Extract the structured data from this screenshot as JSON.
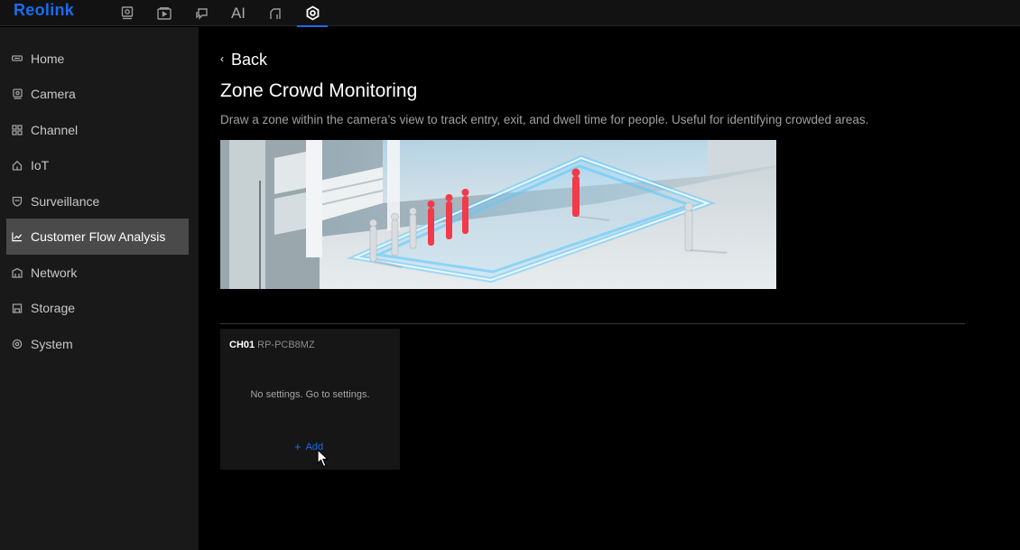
{
  "app": {
    "logo": "Reolink",
    "accent": "#1a6cf0"
  },
  "topnav": [
    {
      "name": "live-view",
      "icon": "camera-square-icon"
    },
    {
      "name": "playback",
      "icon": "playback-icon"
    },
    {
      "name": "messages",
      "icon": "chat-icon"
    },
    {
      "name": "ai",
      "label": "AI"
    },
    {
      "name": "files",
      "icon": "file-corner-icon"
    },
    {
      "name": "settings",
      "icon": "gear-icon",
      "active": true
    }
  ],
  "sidebar": {
    "items": [
      {
        "label": "Home",
        "icon": "home-icon"
      },
      {
        "label": "Camera",
        "icon": "camera-icon"
      },
      {
        "label": "Channel",
        "icon": "grid-icon"
      },
      {
        "label": "IoT",
        "icon": "house-icon"
      },
      {
        "label": "Surveillance",
        "icon": "shield-icon"
      },
      {
        "label": "Customer Flow Analysis",
        "icon": "chart-line-icon",
        "active": true
      },
      {
        "label": "Network",
        "icon": "network-icon"
      },
      {
        "label": "Storage",
        "icon": "storage-icon"
      },
      {
        "label": "System",
        "icon": "system-gear-icon"
      }
    ]
  },
  "main": {
    "back_label": "Back",
    "title": "Zone Crowd Monitoring",
    "description": "Draw a zone within the camera’s view to track entry, exit, and dwell time for people. Useful for identifying crowded areas."
  },
  "card": {
    "channel": "CH01",
    "model": "RP-PCB8MZ",
    "message": "No settings. Go to settings.",
    "add_label": "Add"
  }
}
